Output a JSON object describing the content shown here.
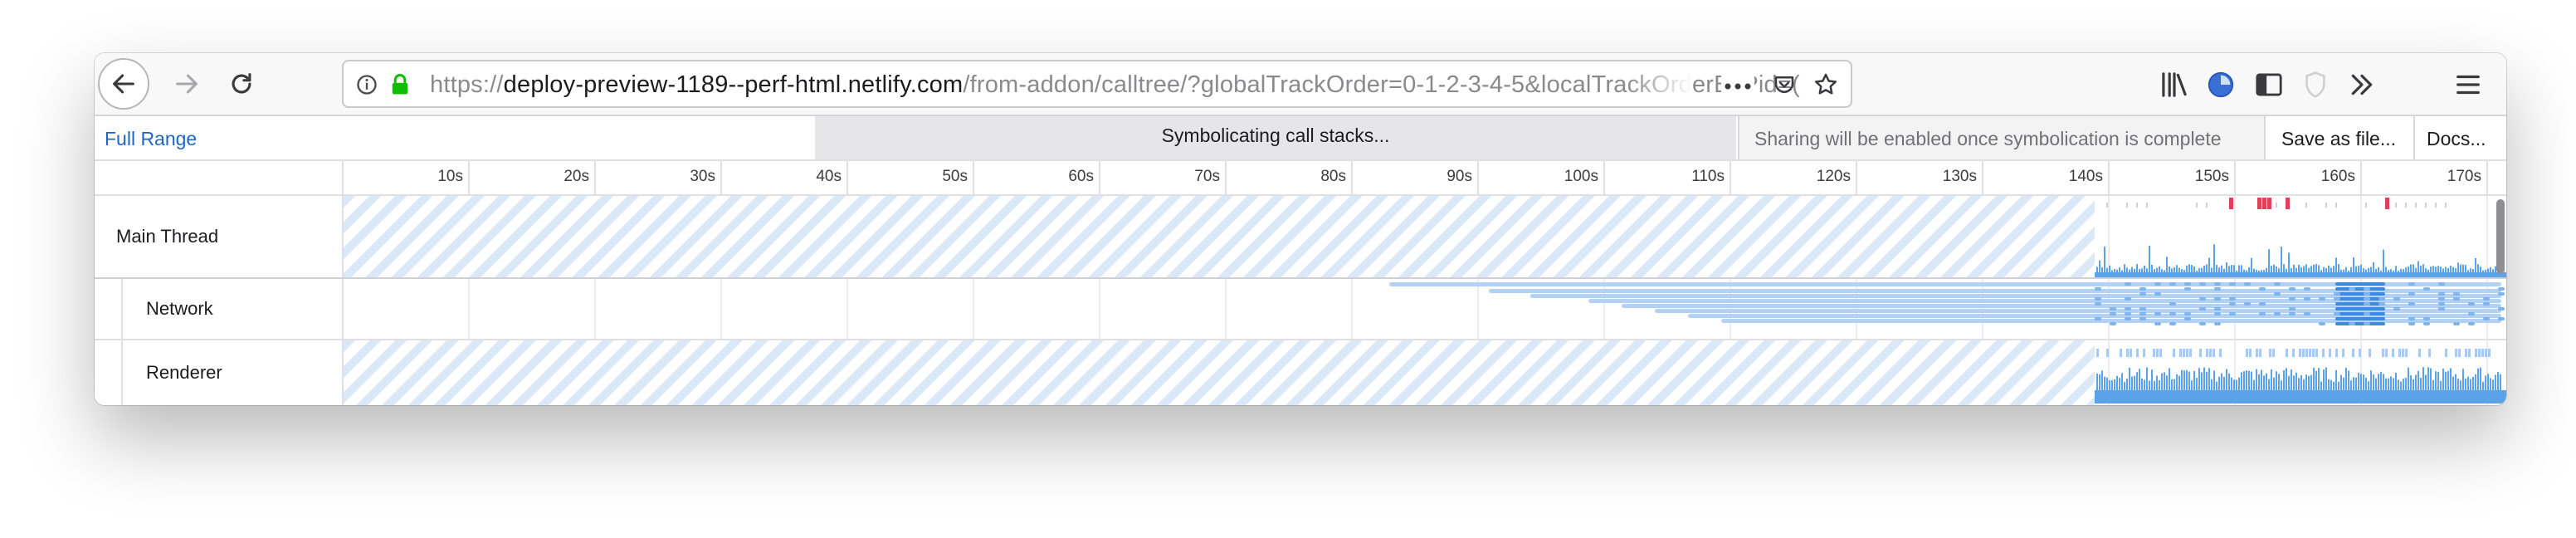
{
  "browser": {
    "url_scheme": "https://",
    "url_host": "deploy-preview-1189--perf-html.netlify.com",
    "url_path": "/from-addon/calltree/?globalTrackOrder=0-1-2-3-4-5&localTrackOrderByPid=("
  },
  "header": {
    "full_range_label": "Full Range",
    "symbolicating_text": "Symbolicating call stacks...",
    "sharing_text": "Sharing will be enabled once symbolication is complete",
    "save_label": "Save as file...",
    "docs_label": "Docs..."
  },
  "timeline": {
    "ticks": [
      "10s",
      "20s",
      "30s",
      "40s",
      "50s",
      "60s",
      "70s",
      "80s",
      "90s",
      "100s",
      "110s",
      "120s",
      "130s",
      "140s",
      "150s",
      "160s",
      "170s"
    ],
    "tracks": {
      "main_thread": "Main Thread",
      "network": "Network",
      "renderer": "Renderer"
    }
  },
  "colors": {
    "accent": "#1f65c8",
    "graph_blue": "#5ba2e8",
    "network_bar": "#b3d1f2",
    "marker_red": "#e0405a",
    "hatch": "#dbe8f7"
  }
}
